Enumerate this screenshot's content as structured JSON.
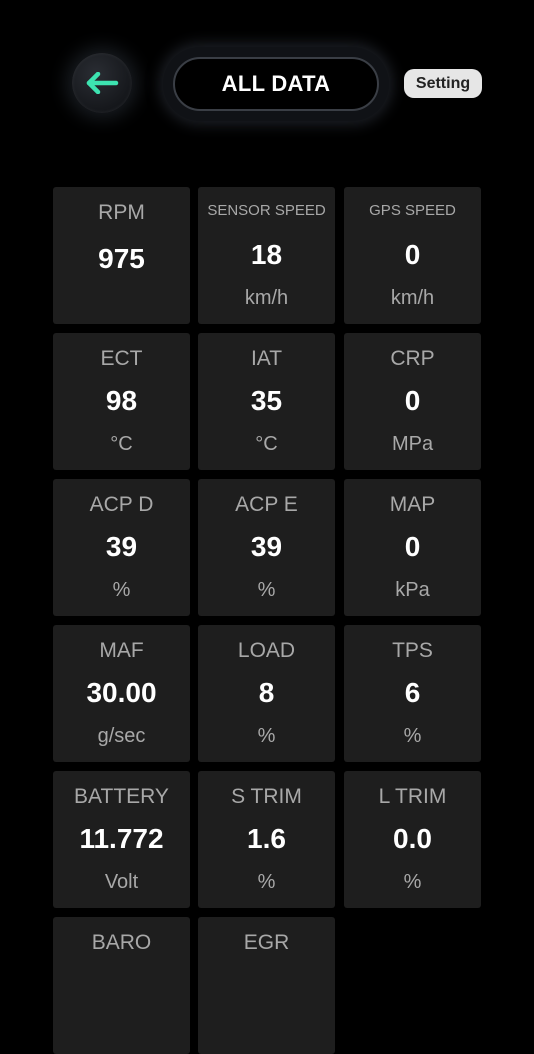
{
  "header": {
    "back_icon": "left-arrow-icon",
    "accent_color": "#3de3b0",
    "title": "ALL DATA",
    "setting_label": "Setting"
  },
  "gauges": [
    {
      "label": "RPM",
      "value": "975",
      "unit": ""
    },
    {
      "label": "SENSOR SPEED",
      "value": "18",
      "unit": "km/h"
    },
    {
      "label": "GPS SPEED",
      "value": "0",
      "unit": "km/h"
    },
    {
      "label": "ECT",
      "value": "98",
      "unit": "°C"
    },
    {
      "label": "IAT",
      "value": "35",
      "unit": "°C"
    },
    {
      "label": "CRP",
      "value": "0",
      "unit": "MPa"
    },
    {
      "label": "ACP D",
      "value": "39",
      "unit": "%"
    },
    {
      "label": "ACP E",
      "value": "39",
      "unit": "%"
    },
    {
      "label": "MAP",
      "value": "0",
      "unit": "kPa"
    },
    {
      "label": "MAF",
      "value": "30.00",
      "unit": "g/sec"
    },
    {
      "label": "LOAD",
      "value": "8",
      "unit": "%"
    },
    {
      "label": "TPS",
      "value": "6",
      "unit": "%"
    },
    {
      "label": "BATTERY",
      "value": "11.772",
      "unit": "Volt"
    },
    {
      "label": "S TRIM",
      "value": "1.6",
      "unit": "%"
    },
    {
      "label": "L TRIM",
      "value": "0.0",
      "unit": "%"
    },
    {
      "label": "BARO",
      "value": "",
      "unit": ""
    },
    {
      "label": "EGR",
      "value": "",
      "unit": ""
    }
  ]
}
